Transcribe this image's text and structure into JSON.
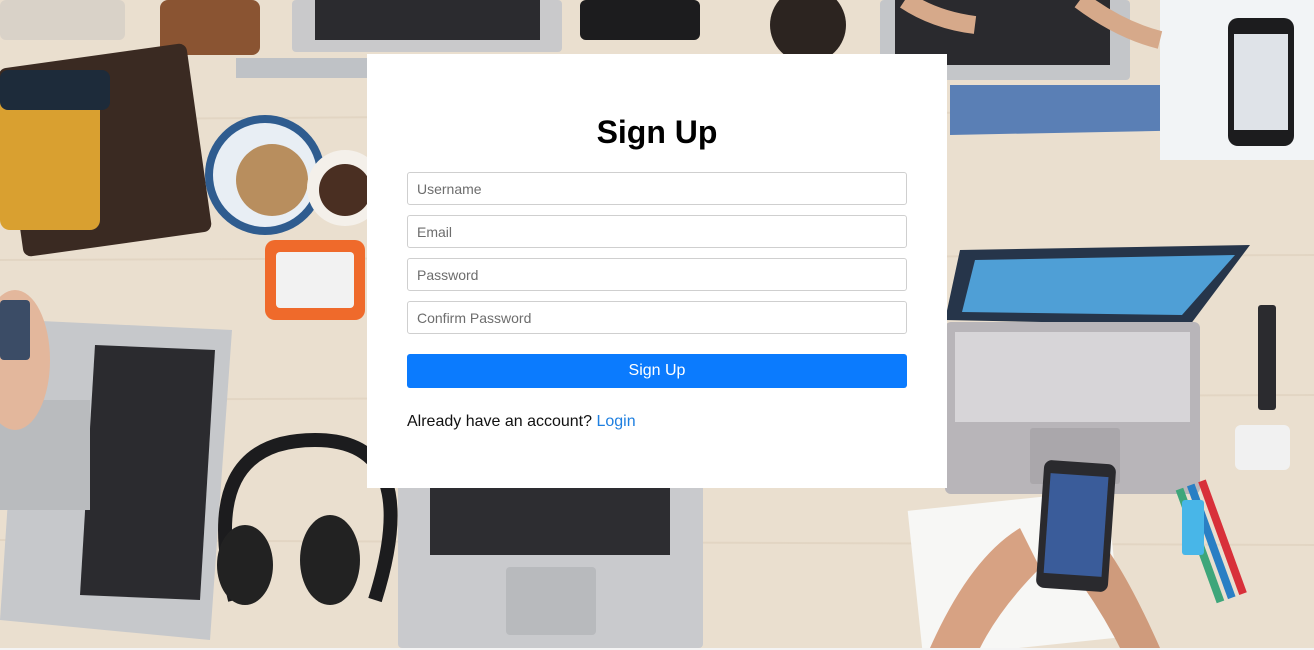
{
  "form": {
    "title": "Sign Up",
    "fields": [
      {
        "placeholder": "Username"
      },
      {
        "placeholder": "Email"
      },
      {
        "placeholder": "Password"
      },
      {
        "placeholder": "Confirm Password"
      }
    ],
    "submit_label": "Sign Up",
    "footer_text": "Already have an account?",
    "login_link": "Login"
  },
  "colors": {
    "primary_button": "#0b7bfe",
    "link": "#1e7fe0",
    "card": "#ffffff"
  }
}
